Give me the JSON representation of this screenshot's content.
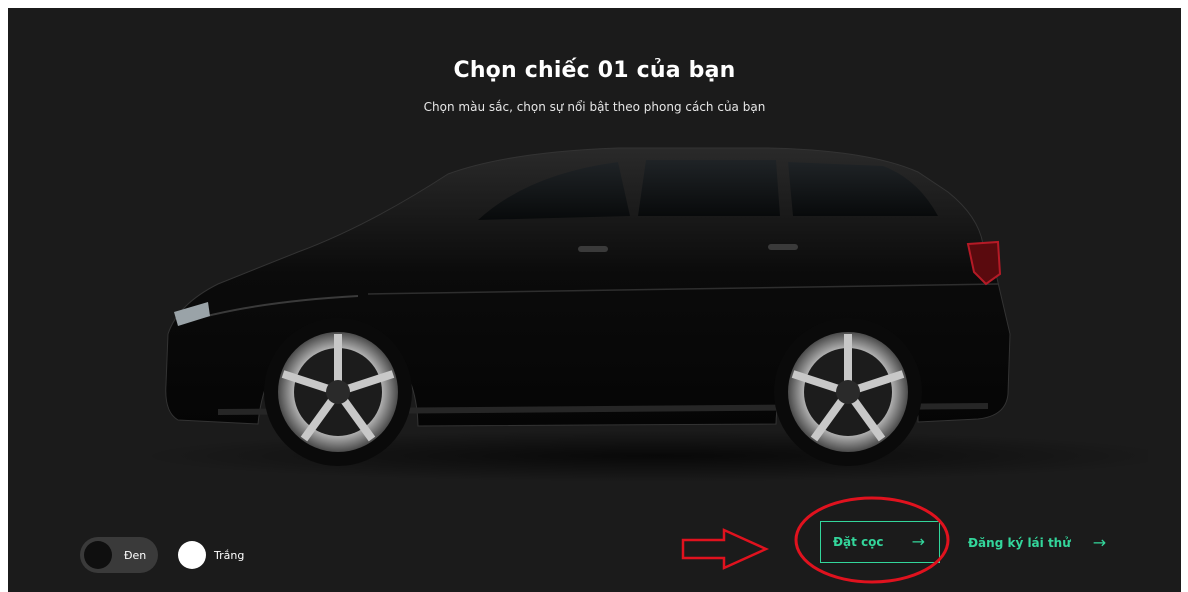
{
  "hero": {
    "title": "Chọn chiếc 01 của bạn",
    "subtitle": "Chọn màu sắc, chọn sự nổi bật theo phong cách của bạn"
  },
  "colors": {
    "options": [
      {
        "label": "Đen",
        "swatch": "#0f0f0f",
        "selected": true
      },
      {
        "label": "Trắng",
        "swatch": "#ffffff",
        "selected": false
      }
    ]
  },
  "actions": {
    "deposit_label": "Đặt cọc",
    "test_drive_label": "Đăng ký lái thử",
    "arrow_icon": "arrow-right-icon"
  },
  "theme": {
    "background": "#1b1b1b",
    "accent": "#33d69b",
    "annotation": "#e0121e"
  },
  "annotations": {
    "icons": [
      "red-pointer-arrow",
      "red-highlight-ellipse"
    ]
  }
}
